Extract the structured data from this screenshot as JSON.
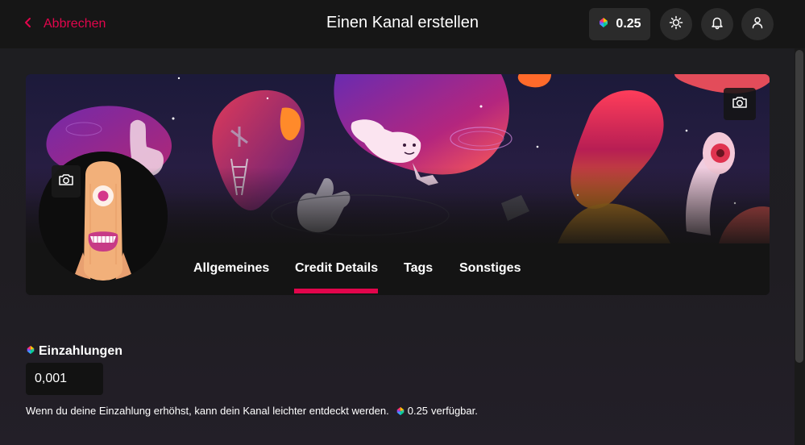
{
  "header": {
    "cancel_label": "Abbrechen",
    "title": "Einen Kanal erstellen",
    "credits_balance": "0.25"
  },
  "icons": {
    "brand_logo": "lbc-credit-icon",
    "theme": "sun-icon",
    "notifications": "bell-icon",
    "account": "user-icon",
    "camera": "camera-icon",
    "back": "chevron-left-icon"
  },
  "tabs": [
    {
      "label": "Allgemeines",
      "active": false
    },
    {
      "label": "Credit Details",
      "active": true
    },
    {
      "label": "Tags",
      "active": false
    },
    {
      "label": "Sonstiges",
      "active": false
    }
  ],
  "deposit": {
    "label": "Einzahlungen",
    "value": "0,001",
    "help_text": "Wenn du deine Einzahlung erhöhst, kann dein Kanal leichter entdeckt werden.",
    "available_amount": "0.25",
    "available_suffix": "verfügbar."
  },
  "colors": {
    "accent": "#e2054c",
    "background": "#1c1b1f",
    "topbar": "#161616",
    "button": "#2b2b2b"
  }
}
